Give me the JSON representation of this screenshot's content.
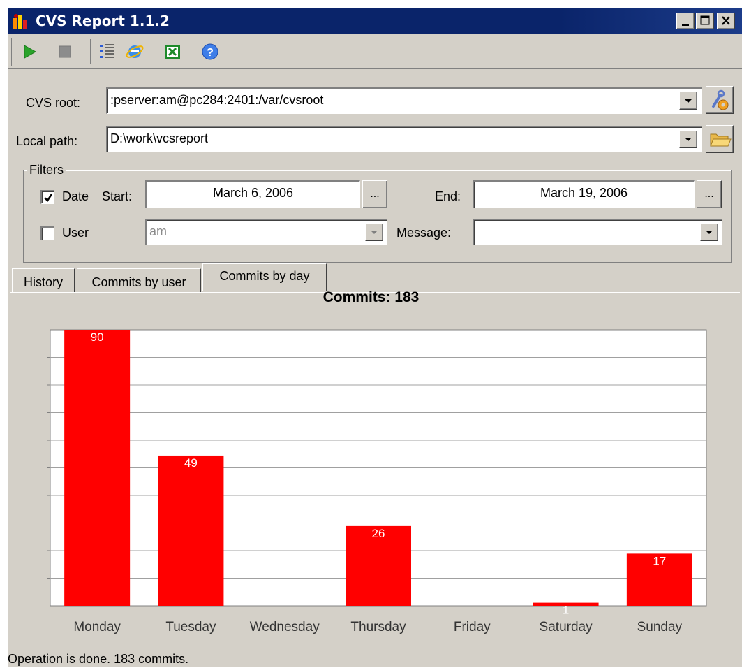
{
  "window": {
    "title": "CVS Report 1.1.2"
  },
  "toolbar": {
    "icons": [
      "play-icon",
      "stop-icon",
      "list-icon",
      "internet-explorer-icon",
      "excel-icon",
      "help-icon"
    ]
  },
  "form": {
    "cvs_root_label": "CVS root:",
    "cvs_root_value": ":pserver:am@pc284:2401:/var/cvsroot",
    "local_path_label": "Local path:",
    "local_path_value": "D:\\work\\vcsreport"
  },
  "filters": {
    "title": "Filters",
    "date_label": "Date",
    "date_checked": true,
    "start_label": "Start:",
    "start_value": "March 6, 2006",
    "end_label": "End:",
    "end_value": "March 19, 2006",
    "browse_label": "...",
    "user_label": "User",
    "user_checked": false,
    "user_value": "am",
    "message_label": "Message:",
    "message_value": ""
  },
  "tabs": [
    {
      "label": "History",
      "active": false
    },
    {
      "label": "Commits by user",
      "active": false
    },
    {
      "label": "Commits by day",
      "active": true
    }
  ],
  "chart_data": {
    "type": "bar",
    "title": "Commits: 183",
    "categories": [
      "Monday",
      "Tuesday",
      "Wednesday",
      "Thursday",
      "Friday",
      "Saturday",
      "Sunday"
    ],
    "values": [
      90,
      49,
      0,
      26,
      0,
      1,
      17
    ],
    "data_labels": [
      "90",
      "49",
      "",
      "26",
      "",
      "1",
      "17"
    ],
    "ylim": [
      0,
      90
    ],
    "grid": true,
    "bar_color": "#ff0000",
    "label_color": "#ffffff"
  },
  "status": {
    "text": "Operation is done. 183 commits."
  },
  "colors": {
    "titlebar": "#0a246a",
    "face": "#d4d0c8"
  }
}
